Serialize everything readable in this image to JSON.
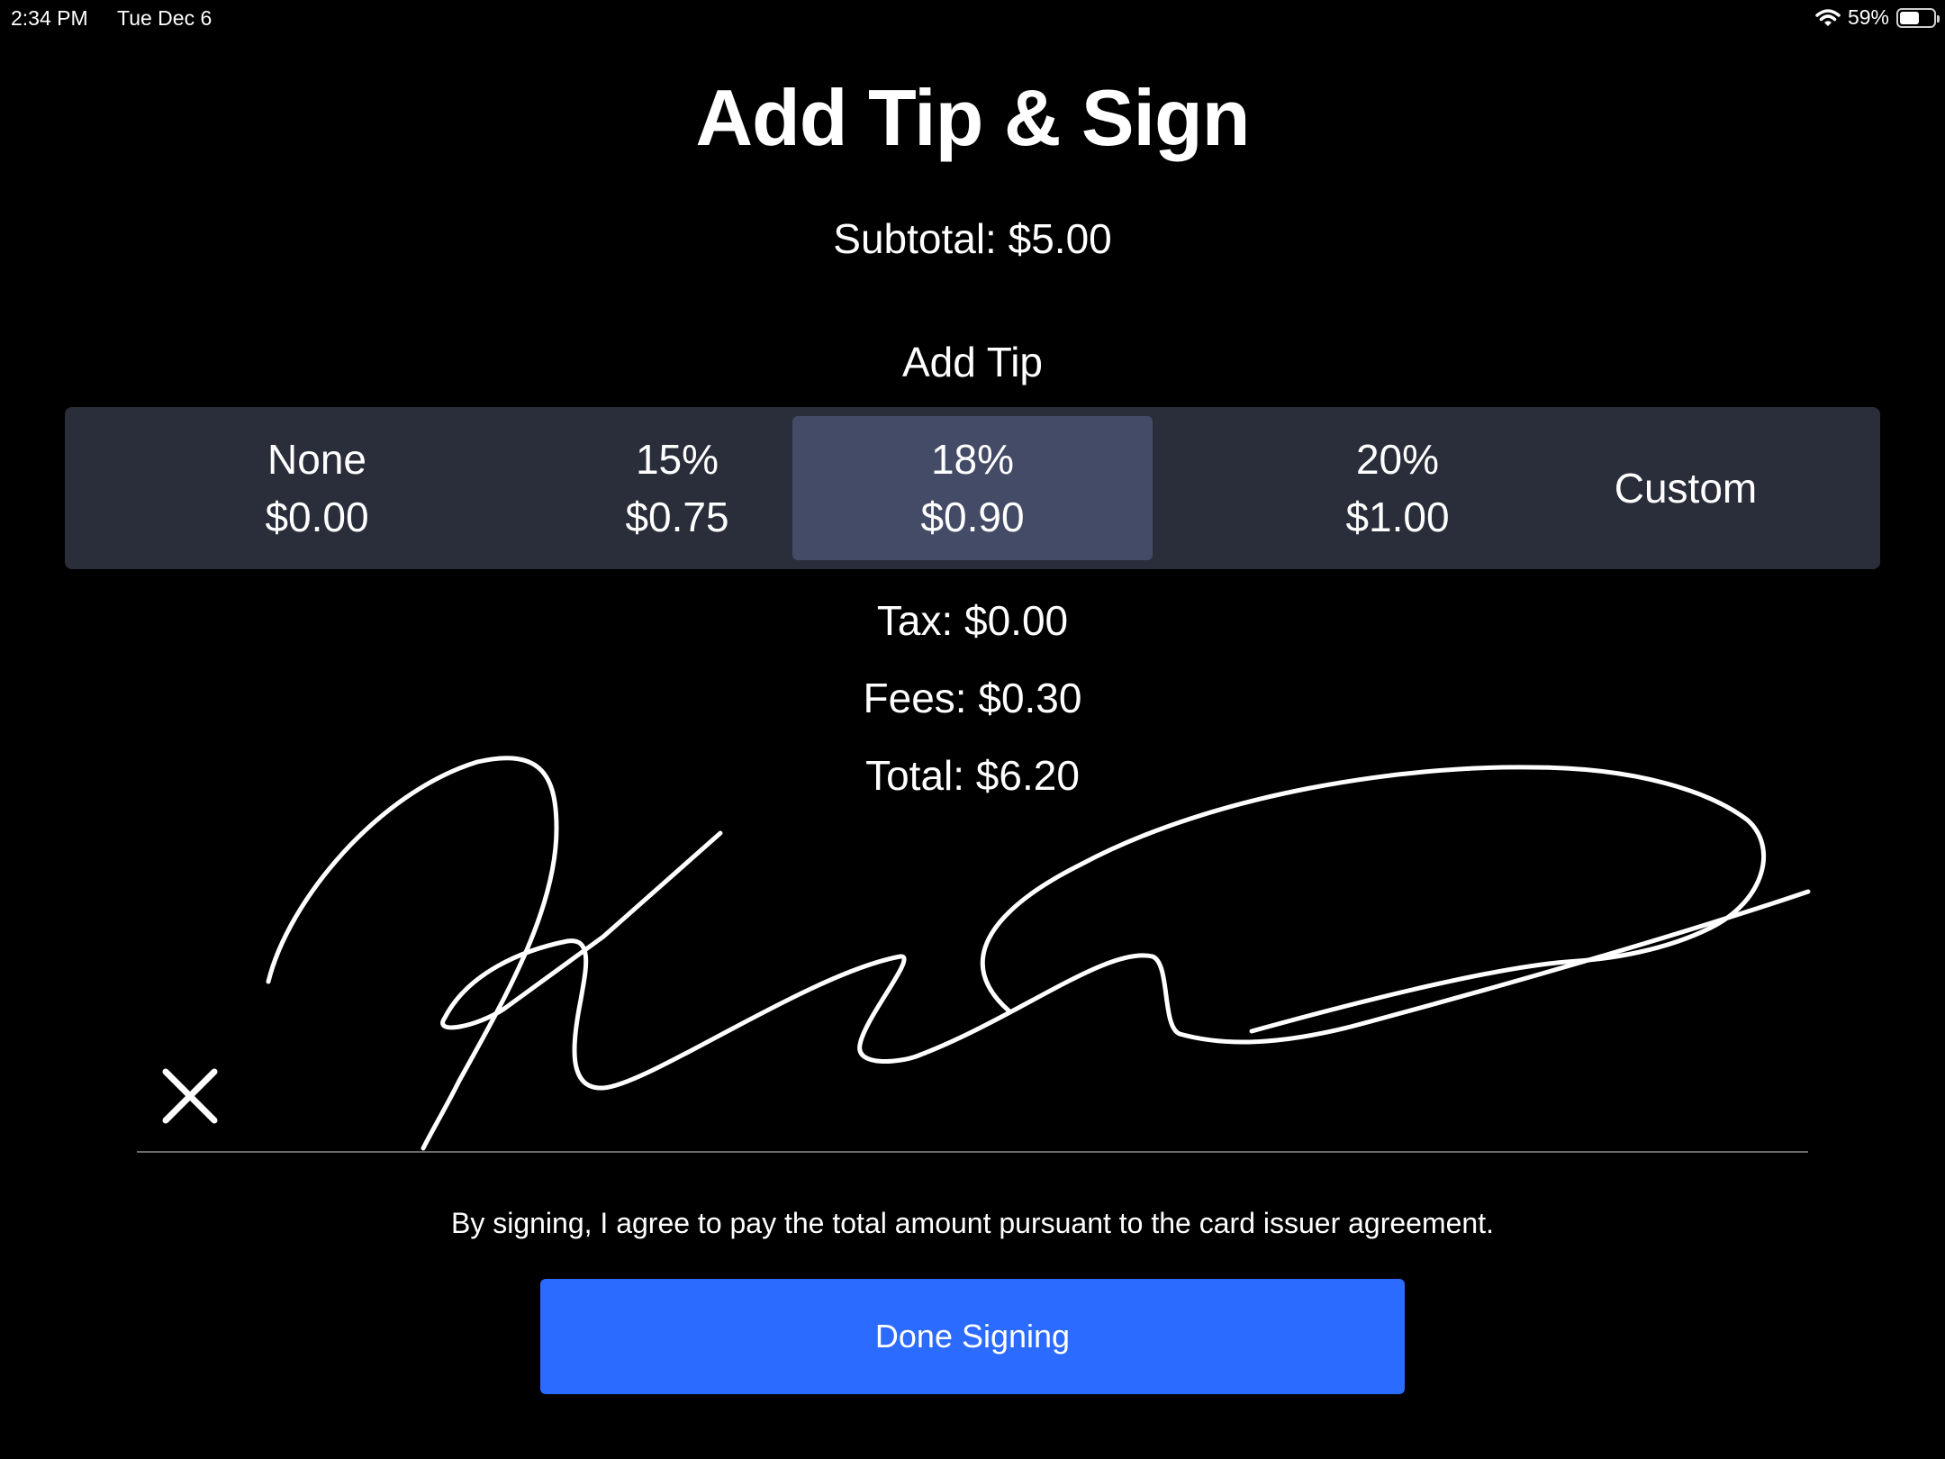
{
  "status_bar": {
    "time": "2:34 PM",
    "date": "Tue Dec 6",
    "battery_percent": "59%",
    "battery_level": 0.59
  },
  "title": "Add Tip & Sign",
  "subtotal": "Subtotal: $5.00",
  "tip_heading": "Add Tip",
  "tip_options": [
    {
      "label": "None",
      "amount": "$0.00",
      "selected": false
    },
    {
      "label": "15%",
      "amount": "$0.75",
      "selected": false
    },
    {
      "label": "18%",
      "amount": "$0.90",
      "selected": true
    },
    {
      "label": "20%",
      "amount": "$1.00",
      "selected": false
    },
    {
      "label": "Custom",
      "amount": "",
      "selected": false
    }
  ],
  "tax": "Tax: $0.00",
  "fees": "Fees: $0.30",
  "total": "Total: $6.20",
  "agreement_text": "By signing, I agree to pay the total amount pursuant to the card issuer agreement.",
  "done_button_label": "Done Signing",
  "colors": {
    "background": "#000000",
    "segment": "#2a2e3a",
    "segment_selected": "#444b66",
    "primary_button": "#2c6bff"
  }
}
